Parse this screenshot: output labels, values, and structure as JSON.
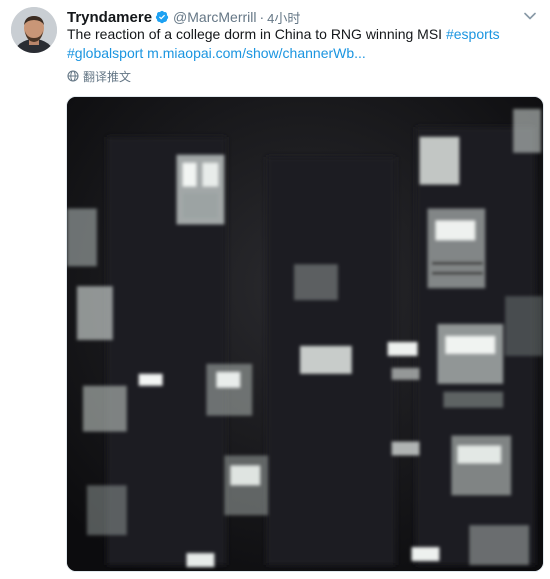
{
  "tweet": {
    "author": {
      "display_name": "Tryndamere",
      "handle": "@MarcMerrill",
      "verified": true,
      "avatar_icon": "user-avatar-photo"
    },
    "separator": "·",
    "timestamp": "4小时",
    "text": {
      "line1_plain": "The reaction of a college dorm in China to RNG winning MSI ",
      "hashtag1": "#esports",
      "hashtag2": "#globalsport",
      "link": "m.miaopai.com/show/channerWb..."
    },
    "translate_label": "翻译推文",
    "media": {
      "type": "video",
      "description_icon": "night-dorm-building-video"
    },
    "colors": {
      "link": "#1b95e0",
      "verified": "#1da1f2",
      "secondary_text": "#657786",
      "primary_text": "#14171a"
    }
  }
}
